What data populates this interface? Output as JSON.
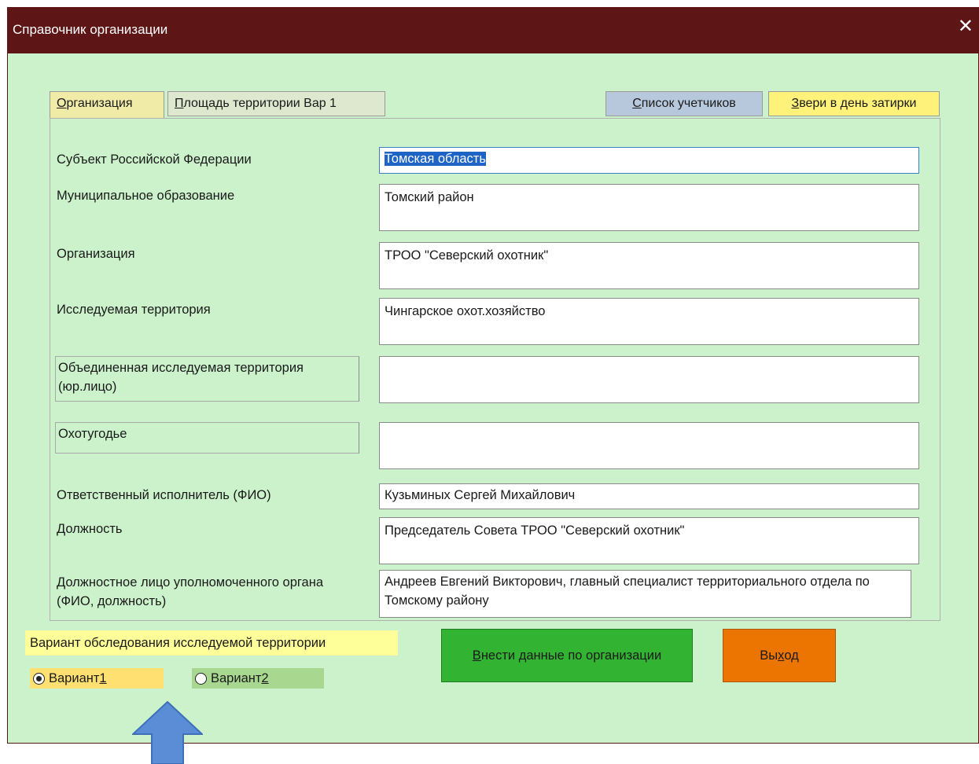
{
  "window": {
    "title": "Справочник организации",
    "close_glyph": "✕"
  },
  "tabs": [
    {
      "accel": "О",
      "rest": "рганизация"
    },
    {
      "accel": "П",
      "rest": "лощадь территории Вар 1"
    },
    {
      "accel": "С",
      "rest": "писок учетчиков"
    },
    {
      "accel": "З",
      "rest": "вери в день затирки"
    }
  ],
  "form": {
    "subject_label": "Субъект Российской Федерации",
    "subject_value": "Томская область",
    "municipal_label": "Муниципальное образование",
    "municipal_value": "Томский район",
    "org_label": "Организация",
    "org_value": "ТРОО \"Северский охотник\"",
    "territory_label": "Исследуемая территория",
    "territory_value": "Чингарское охот.хозяйство",
    "united_label": "Объединенная исследуемая территория (юр.лицо)",
    "united_value": "",
    "hunting_label": "Охотугодье",
    "hunting_value": "",
    "responsible_label": "Ответственный исполнитель (ФИО)",
    "responsible_value": "Кузьминых Сергей Михайлович",
    "position_label": "Должность",
    "position_value": "Председатель Совета ТРОО \"Северский охотник\"",
    "official_label": "Должностное лицо уполномоченного органа (ФИО, должность)",
    "official_value": "Андреев Евгений Викторович, главный специалист территориального отдела по Томскому району"
  },
  "variant": {
    "label": "Вариант обследования исследуемой территории",
    "options": [
      {
        "text": "Вариант ",
        "accel": "1",
        "selected": true
      },
      {
        "text": "Вариант ",
        "accel": "2",
        "selected": false
      }
    ]
  },
  "buttons": {
    "submit": {
      "accel": "В",
      "rest": "нести данные по организации"
    },
    "exit": {
      "pre": "Вы",
      "accel": "х",
      "rest": "од"
    }
  },
  "colors": {
    "titlebar": "#5e1515",
    "background": "#ccf2cc",
    "tab_list": "#b8c8dc",
    "tab_animals": "#fff27a",
    "submit_button": "#32b432",
    "exit_button": "#ec7400",
    "variant1": "#ffe070",
    "variant2": "#a8d890",
    "arrow": "#5b8dd6"
  }
}
